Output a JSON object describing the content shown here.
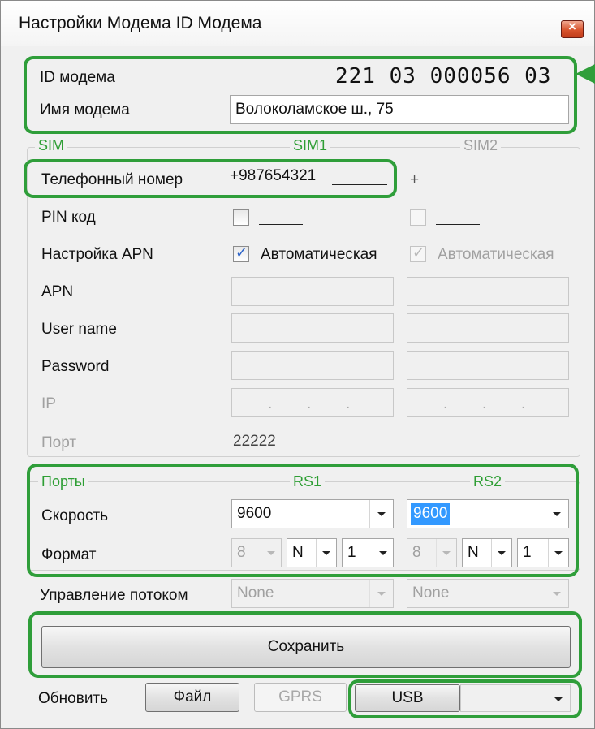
{
  "window": {
    "title": "Настройки Модема ID Модема",
    "close_symbol": "×"
  },
  "modem": {
    "id_label": "ID модема",
    "id_value": "221  03  000056  03",
    "name_label": "Имя модема",
    "name_value": "Волоколамское ш., 75"
  },
  "sim": {
    "group_title": "SIM",
    "sim1_title": "SIM1",
    "sim2_title": "SIM2",
    "phone_label": "Телефонный номер",
    "phone_sim1": "+987654321",
    "phone_sim2": "+",
    "pin_label": "PIN код",
    "apn_setup_label": "Настройка APN",
    "apn_auto_sim1": "Автоматическая",
    "apn_auto_sim2": "Автоматическая",
    "apn_label": "APN",
    "user_label": "User name",
    "password_label": "Password",
    "ip_label": "IP",
    "port_label": "Порт",
    "port_value": "22222",
    "check_mark": "✓"
  },
  "ports": {
    "group_title": "Порты",
    "rs1_title": "RS1",
    "rs2_title": "RS2",
    "speed_label": "Скорость",
    "speed_rs1": "9600",
    "speed_rs2": "9600",
    "format_label": "Формат",
    "rs1_bits": "8",
    "rs1_parity": "N",
    "rs1_stop": "1",
    "rs2_bits": "8",
    "rs2_parity": "N",
    "rs2_stop": "1",
    "flow_label": "Управление потоком",
    "flow_rs1": "None",
    "flow_rs2": "None"
  },
  "actions": {
    "save_label": "Сохранить",
    "refresh_label": "Обновить",
    "file_label": "Файл",
    "gprs_label": "GPRS",
    "usb_label": "USB",
    "usb_port_value": ""
  },
  "colors": {
    "highlight": "#2f9e3a",
    "group_title": "#2e9e34",
    "selection": "#3399ff"
  }
}
